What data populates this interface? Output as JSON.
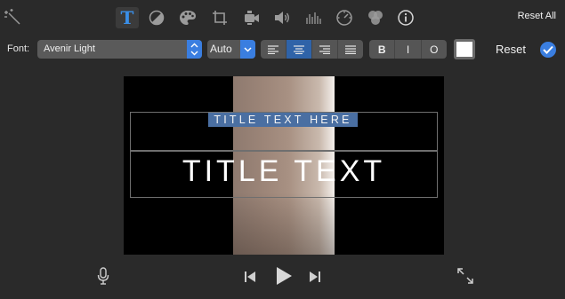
{
  "toolbar": {
    "tools": [
      {
        "name": "magic-wand-icon"
      },
      {
        "name": "title-icon",
        "glyph": "T",
        "active": true
      },
      {
        "name": "color-balance-icon"
      },
      {
        "name": "color-palette-icon"
      },
      {
        "name": "crop-icon"
      },
      {
        "name": "stabilization-icon"
      },
      {
        "name": "volume-icon"
      },
      {
        "name": "equalizer-icon"
      },
      {
        "name": "speed-icon"
      },
      {
        "name": "filter-icon"
      },
      {
        "name": "info-icon"
      }
    ],
    "reset_all_label": "Reset All",
    "accent_color": "#3a8fe8"
  },
  "font_controls": {
    "font_label": "Font:",
    "font_value": "Avenir Light",
    "size_value": "Auto",
    "alignments": [
      "align-left",
      "align-center",
      "align-right",
      "align-justify"
    ],
    "selected_alignment": "align-center",
    "style_buttons": [
      "B",
      "I",
      "O"
    ],
    "text_color": "#ffffff",
    "reset_label": "Reset"
  },
  "viewer": {
    "subtitle": "TITLE TEXT HERE",
    "title": "TITLE TEXT"
  },
  "playback": {
    "controls": [
      "microphone-icon",
      "skip-back-icon",
      "play-icon",
      "skip-forward-icon",
      "fullscreen-icon"
    ]
  }
}
